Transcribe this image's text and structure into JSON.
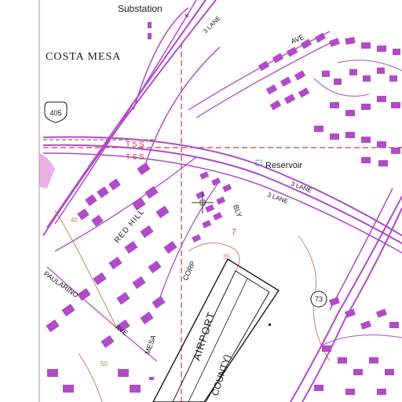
{
  "map": {
    "labels": {
      "substation": "Substation",
      "city": "COSTA MESA",
      "township_top": "T 5 S",
      "township_bottom": "T 6 S",
      "reservoir": "Reservoir",
      "ave_top": "AVE",
      "lane_top": "3 LANE",
      "lane_right_1": "3 LANE",
      "lane_right_2": "3 LANE",
      "red_hill": "RED HILL",
      "corp": "CORP",
      "bly": "BLY",
      "paularino": "PAULARINO",
      "paularino_ave": "AVE",
      "mesa": "MESA",
      "airport": "AIRPORT",
      "county": "COUNTY)",
      "section": "7",
      "contour_40": "40",
      "contour_35": "35",
      "contour_50": "50"
    },
    "routes": {
      "interstate": "405",
      "state": "73"
    },
    "colors": {
      "urban_fill": "#b04cc8",
      "township_line": "#d63a3a",
      "contour": "#c07a55",
      "airport_ink": "#1a1a1a"
    },
    "crosshair": "crosshair-icon"
  }
}
